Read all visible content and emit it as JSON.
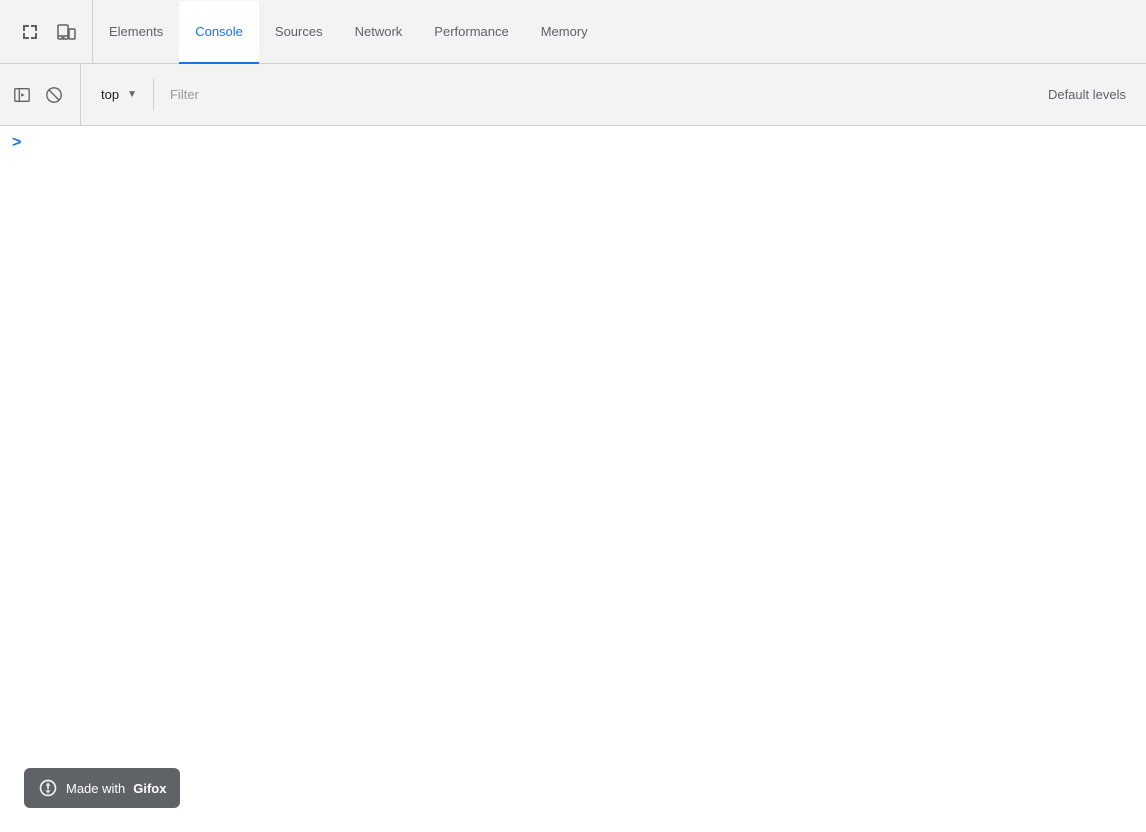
{
  "toolbar": {
    "tabs": [
      {
        "id": "elements",
        "label": "Elements",
        "active": false
      },
      {
        "id": "console",
        "label": "Console",
        "active": true
      },
      {
        "id": "sources",
        "label": "Sources",
        "active": false
      },
      {
        "id": "network",
        "label": "Network",
        "active": false
      },
      {
        "id": "performance",
        "label": "Performance",
        "active": false
      },
      {
        "id": "memory",
        "label": "Memory",
        "active": false
      }
    ]
  },
  "console_toolbar": {
    "context_label": "top",
    "filter_placeholder": "Filter",
    "default_levels_label": "Default levels"
  },
  "console": {
    "prompt_symbol": ">"
  },
  "gifox": {
    "text_normal": "Made with ",
    "text_bold": "Gifox"
  }
}
